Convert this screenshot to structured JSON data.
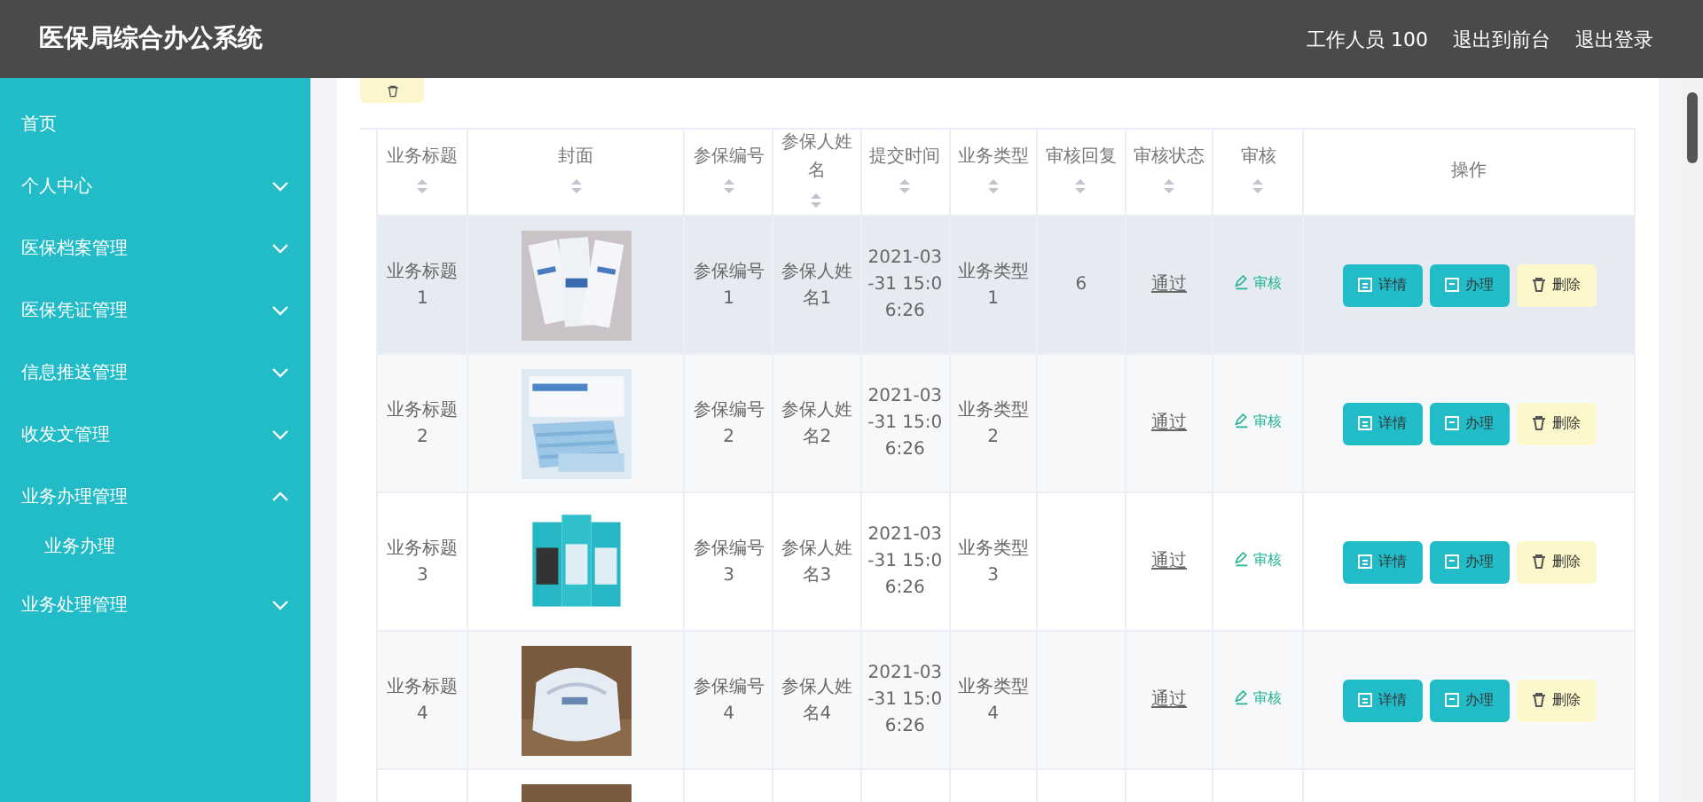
{
  "header": {
    "title": "医保局综合办公系统",
    "links": [
      "工作人员 100",
      "退出到前台",
      "退出登录"
    ]
  },
  "sidebar": {
    "items": [
      {
        "label": "首页",
        "kind": "link"
      },
      {
        "label": "个人中心",
        "kind": "menu",
        "expanded": false
      },
      {
        "label": "医保档案管理",
        "kind": "menu",
        "expanded": false
      },
      {
        "label": "医保凭证管理",
        "kind": "menu",
        "expanded": false
      },
      {
        "label": "信息推送管理",
        "kind": "menu",
        "expanded": false
      },
      {
        "label": "收发文管理",
        "kind": "menu",
        "expanded": false
      },
      {
        "label": "业务办理管理",
        "kind": "menu",
        "expanded": true,
        "children": [
          {
            "label": "业务办理"
          }
        ]
      },
      {
        "label": "业务处理管理",
        "kind": "menu",
        "expanded": false
      }
    ]
  },
  "table": {
    "columns": [
      {
        "label": "业务标题",
        "sortable": true
      },
      {
        "label": "封面",
        "sortable": true
      },
      {
        "label": "参保编号",
        "sortable": true
      },
      {
        "label": "参保人姓名",
        "sortable": true
      },
      {
        "label": "提交时间",
        "sortable": true
      },
      {
        "label": "业务类型",
        "sortable": true
      },
      {
        "label": "审核回复",
        "sortable": true
      },
      {
        "label": "审核状态",
        "sortable": true
      },
      {
        "label": "审核",
        "sortable": true
      },
      {
        "label": "操作",
        "sortable": false
      }
    ],
    "rows": [
      {
        "hovered": true,
        "title": "业务标题1",
        "cover": {
          "kind": "picture"
        },
        "number": "参保编号1",
        "name": "参保人姓名1",
        "time": "2021-03-31 15:06:26",
        "type": "业务类型1",
        "reply": "6",
        "status": "通过",
        "review": "审核",
        "actions": [
          "详情",
          "办理",
          "删除"
        ]
      },
      {
        "hovered": false,
        "title": "业务标题2",
        "cover": {
          "kind": "picture"
        },
        "number": "参保编号2",
        "name": "参保人姓名2",
        "time": "2021-03-31 15:06:26",
        "type": "业务类型2",
        "status": "通过",
        "review": "审核",
        "actions": [
          "详情",
          "办理",
          "删除"
        ]
      },
      {
        "hovered": false,
        "title": "业务标题3",
        "cover": {
          "kind": "picture"
        },
        "number": "参保编号3",
        "name": "参保人姓名3",
        "time": "2021-03-31 15:06:26",
        "type": "业务类型3",
        "status": "通过",
        "review": "审核",
        "actions": [
          "详情",
          "办理",
          "删除"
        ]
      },
      {
        "hovered": false,
        "title": "业务标题4",
        "cover": {
          "kind": "picture"
        },
        "number": "参保编号4",
        "name": "参保人姓名4",
        "time": "2021-03-31 15:06:26",
        "type": "业务类型4",
        "status": "通过",
        "review": "审核",
        "actions": [
          "详情",
          "办理",
          "删除"
        ]
      }
    ]
  }
}
